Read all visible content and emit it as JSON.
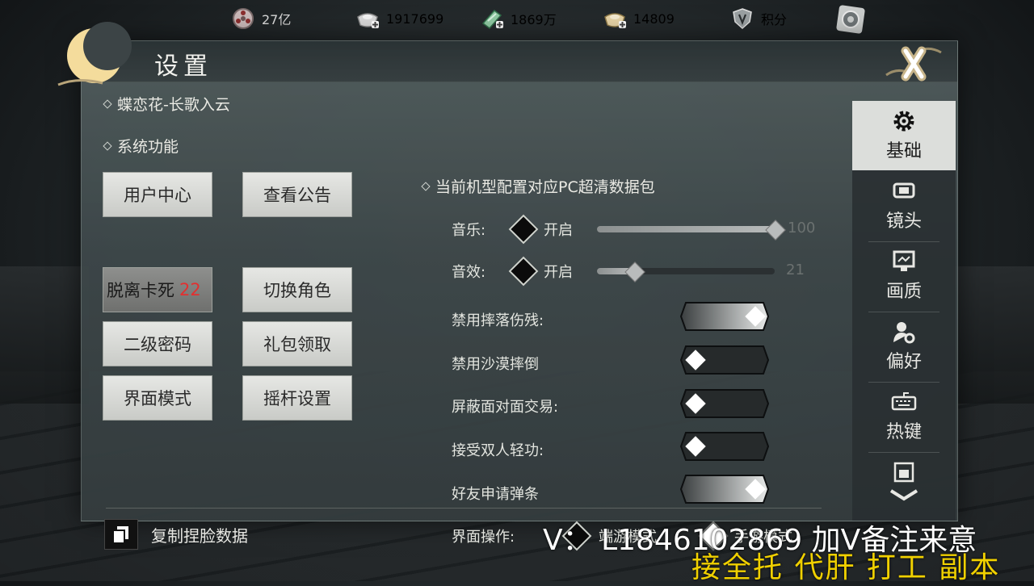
{
  "topbar": {
    "items": [
      {
        "icon": "film-reel-icon",
        "value": "27亿"
      },
      {
        "icon": "silver-ingot-icon",
        "value": "1917699"
      },
      {
        "icon": "jade-icon",
        "value": "1869万"
      },
      {
        "icon": "gold-ingot-icon",
        "value": "14809"
      },
      {
        "icon": "shield-points-icon",
        "value": "积分"
      }
    ],
    "extra_icon": "settings-gear-badge-icon"
  },
  "panel": {
    "title": "设置",
    "server": "蝶恋花-长歌入云",
    "system_section": "系统功能",
    "buttons": [
      {
        "label": "用户中心"
      },
      {
        "label": "查看公告"
      },
      {
        "label": "脱离卡死",
        "countdown": "22"
      },
      {
        "label": "切换角色"
      },
      {
        "label": "二级密码"
      },
      {
        "label": "礼包领取"
      },
      {
        "label": "界面模式"
      },
      {
        "label": "摇杆设置"
      }
    ],
    "copy_face": "复制捏脸数据"
  },
  "settings": {
    "data_pack": "当前机型配置对应PC超清数据包",
    "music": {
      "label": "音乐:",
      "state": "开启",
      "value": "100",
      "level": 100
    },
    "sfx": {
      "label": "音效:",
      "state": "开启",
      "value": "21",
      "level": 21
    },
    "toggles": [
      {
        "label": "禁用摔落伤残:",
        "on": true
      },
      {
        "label": "禁用沙漠摔倒",
        "on": false
      },
      {
        "label": "屏蔽面对面交易:",
        "on": false
      },
      {
        "label": "接受双人轻功:",
        "on": false
      },
      {
        "label": "好友申请弹条",
        "on": true
      }
    ],
    "ui_op": {
      "label": "界面操作:",
      "option1": "端游模式",
      "option2": "手游模式",
      "selected": "手游模式"
    }
  },
  "tabs": [
    {
      "label": "基础",
      "icon": "gear-icon",
      "active": true
    },
    {
      "label": "镜头",
      "icon": "camera-lens-icon",
      "active": false
    },
    {
      "label": "画质",
      "icon": "monitor-icon",
      "active": false
    },
    {
      "label": "偏好",
      "icon": "user-settings-icon",
      "active": false
    },
    {
      "label": "热键",
      "icon": "keyboard-icon",
      "active": false
    },
    {
      "label": "",
      "icon": "shop-icon",
      "active": false
    }
  ],
  "watermark": {
    "line1": "V：  L1846102869 加V备注来意",
    "line2": "接全托 代肝 打工 副本"
  }
}
